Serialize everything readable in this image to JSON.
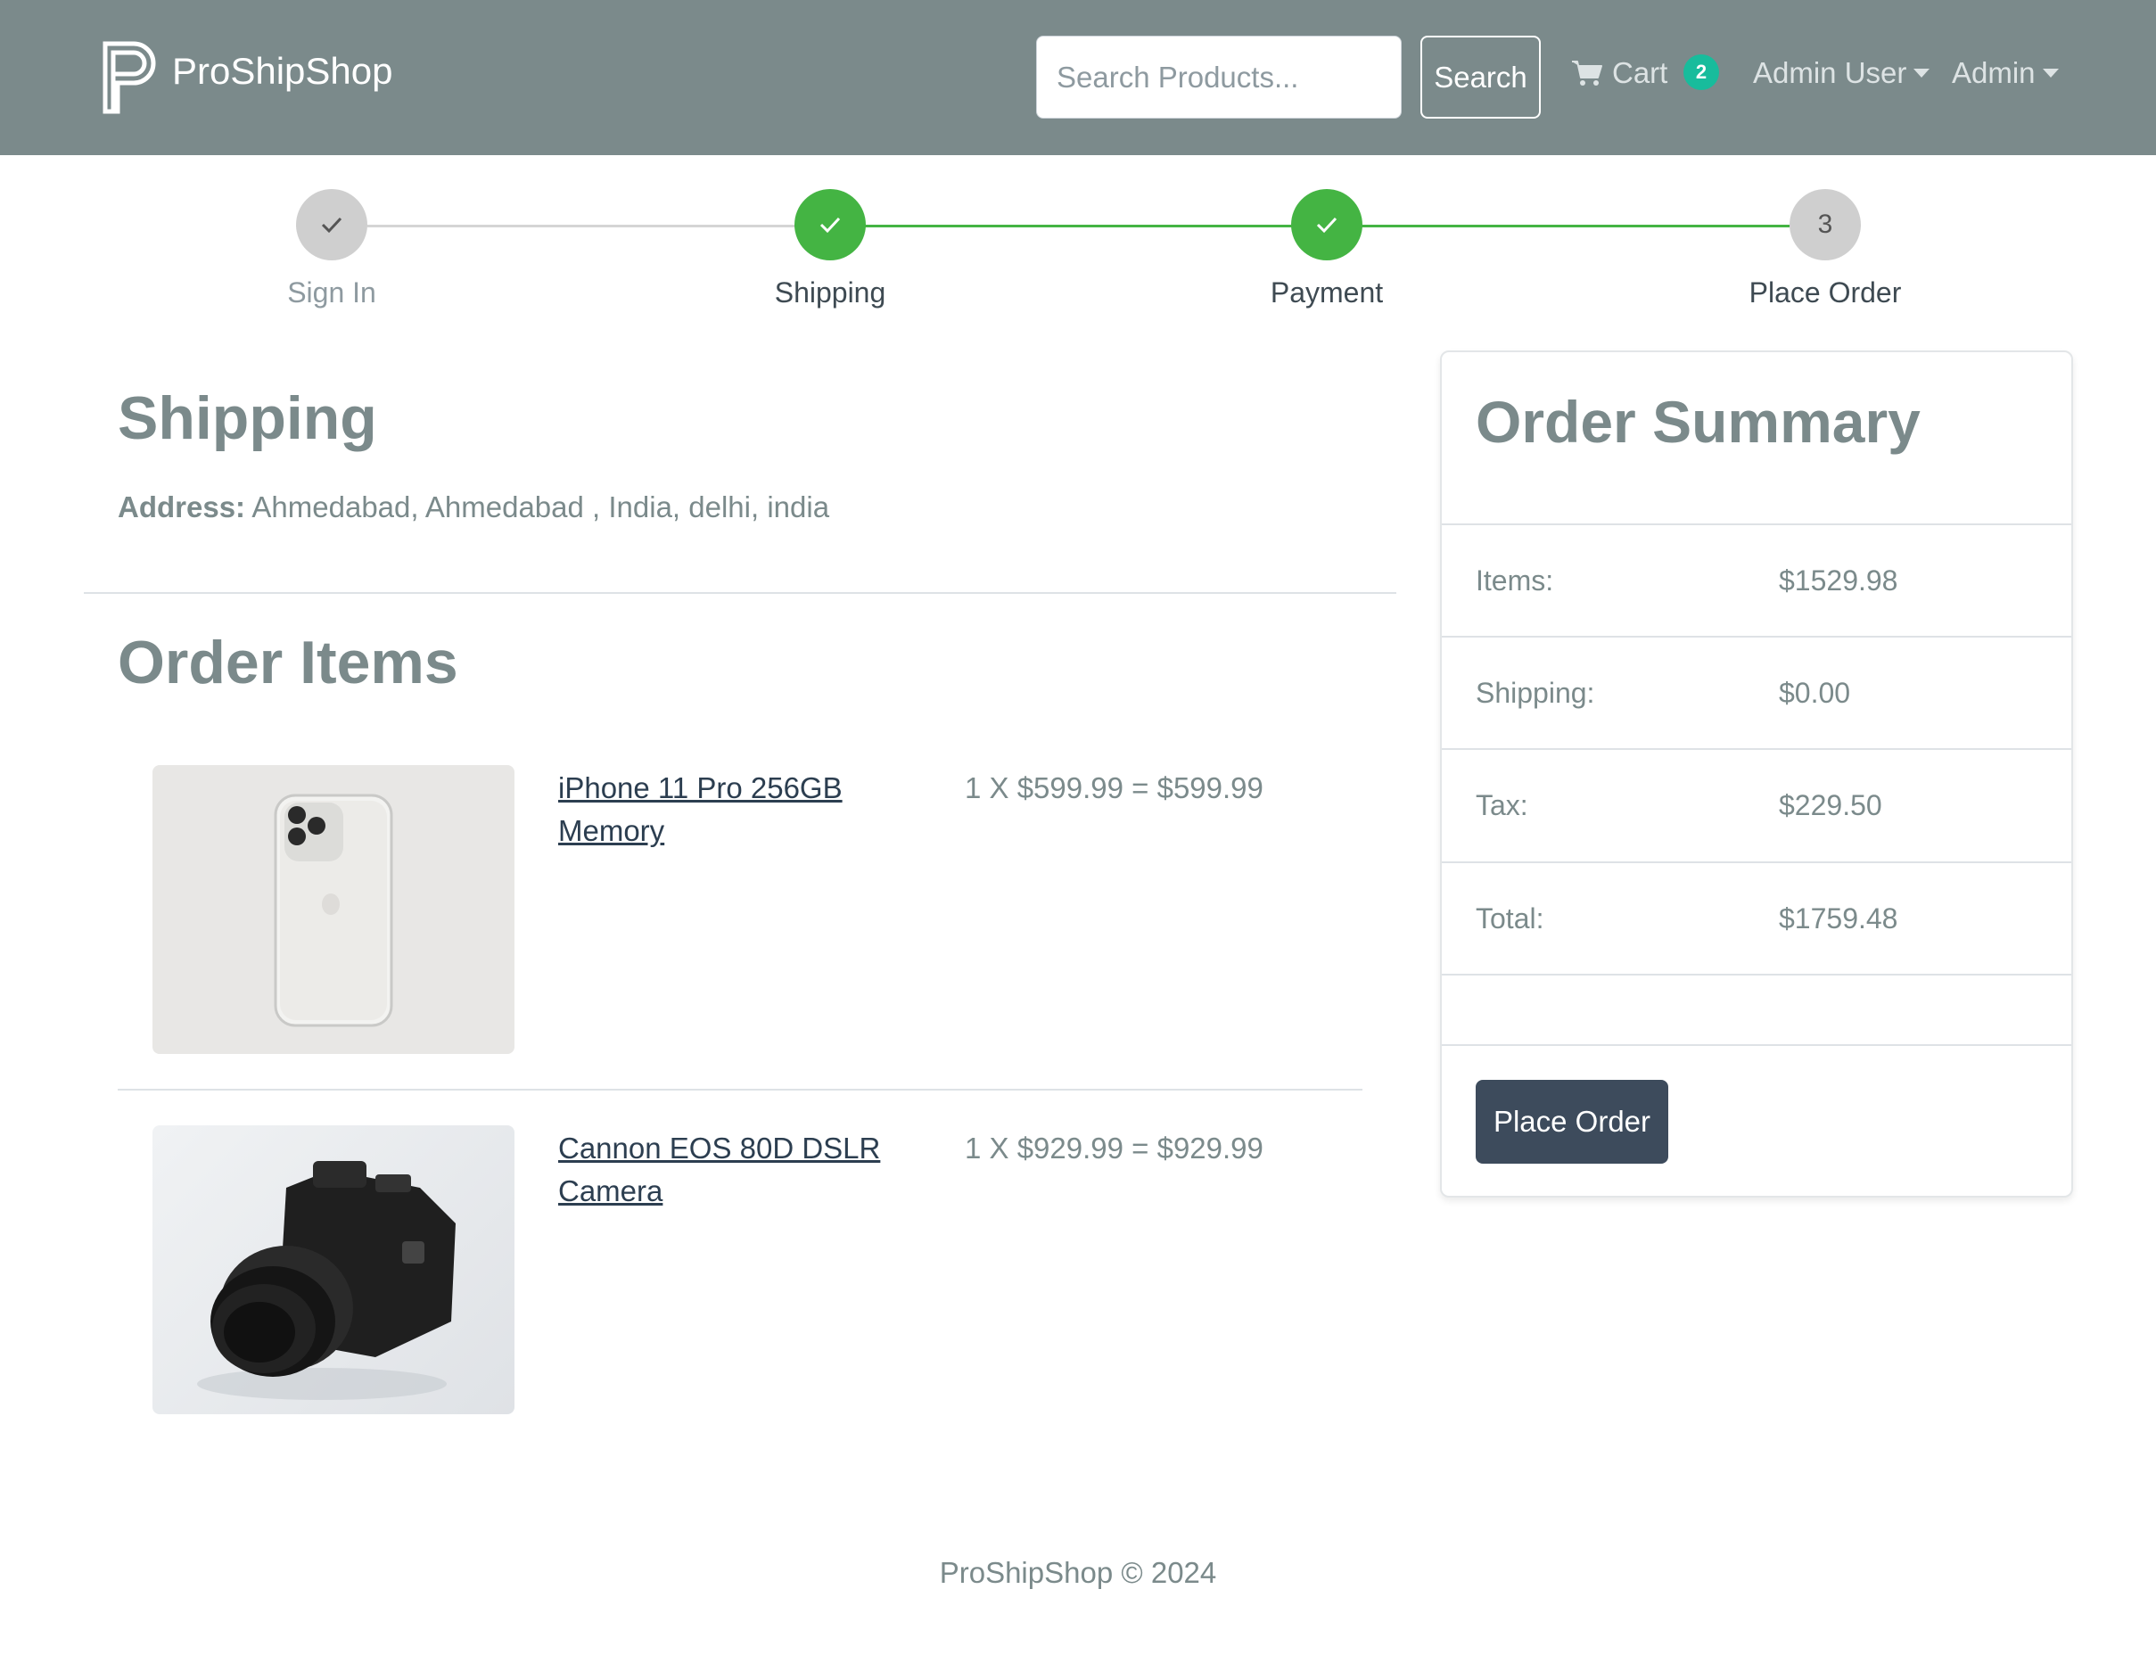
{
  "header": {
    "brand": "ProShipShop",
    "search_placeholder": "Search Products...",
    "search_button": "Search",
    "cart_label": "Cart",
    "cart_count": "2",
    "user_menu": "Admin User",
    "admin_menu": "Admin"
  },
  "steps": [
    {
      "label": "Sign In",
      "state": "inactive",
      "marker": "check"
    },
    {
      "label": "Shipping",
      "state": "complete",
      "marker": "check"
    },
    {
      "label": "Payment",
      "state": "complete",
      "marker": "check"
    },
    {
      "label": "Place Order",
      "state": "inactive",
      "marker": "3"
    }
  ],
  "shipping": {
    "title": "Shipping",
    "address_label": "Address:",
    "address_value": "Ahmedabad, Ahmedabad , India, delhi, india"
  },
  "order_items": {
    "title": "Order Items",
    "items": [
      {
        "name": "iPhone 11 Pro 256GB Memory",
        "price_line": "1 X $599.99 = $599.99",
        "image": "white-smartphone-photo"
      },
      {
        "name": "Cannon EOS 80D DSLR Camera",
        "price_line": "1 X $929.99 = $929.99",
        "image": "black-dslr-camera-photo"
      }
    ]
  },
  "summary": {
    "title": "Order Summary",
    "rows": [
      {
        "label": "Items:",
        "value": "$1529.98"
      },
      {
        "label": "Shipping:",
        "value": "$0.00"
      },
      {
        "label": "Tax:",
        "value": "$229.50"
      },
      {
        "label": "Total:",
        "value": "$1759.48"
      }
    ],
    "place_order_button": "Place Order"
  },
  "footer": {
    "text": "ProShipShop © 2024"
  },
  "colors": {
    "navbar": "#7b8a8b",
    "success": "#44b443",
    "badge": "#18bc9c",
    "primary_button": "#3d4b5c",
    "link": "#2c3e50"
  }
}
